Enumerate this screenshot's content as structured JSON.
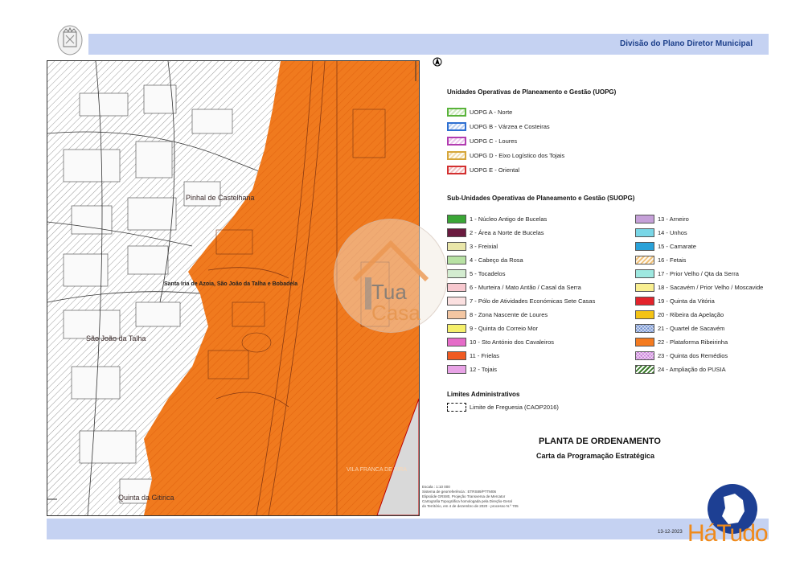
{
  "header": {
    "title": "Divisão do Plano Diretor Municipal"
  },
  "footer": {
    "date": "13-12-2023"
  },
  "map": {
    "places": [
      {
        "name": "Santa Iria de Azoia, São João da Talha e Bobadela"
      },
      {
        "name": "Pinhal de Castelhana"
      },
      {
        "name": "São João da Talha"
      },
      {
        "name": "VILA FRANCA DE XIRA"
      },
      {
        "name": "Quinta da Gitirica"
      }
    ]
  },
  "legend": {
    "uopg_title": "Unidades Operativas de Planeamento e Gestão (UOPG)",
    "uopg": [
      {
        "label": "UOPG A - Norte",
        "color": "#59b33a"
      },
      {
        "label": "UOPG B - Várzea e Costeiras",
        "color": "#2d6fd1"
      },
      {
        "label": "UOPG C - Loures",
        "color": "#b13cb0"
      },
      {
        "label": "UOPG D - Eixo Logístico dos Tojais",
        "color": "#d6a63a"
      },
      {
        "label": "UOPG E - Oriental",
        "color": "#d33030"
      }
    ],
    "suopg_title": "Sub-Unidades Operativas de Planeamento e Gestão (SUOPG)",
    "suopg_left": [
      {
        "label": "1 - Núcleo Antigo de Bucelas",
        "color": "#3aa636"
      },
      {
        "label": "2 - Área a Norte de Bucelas",
        "color": "#6a1a3f"
      },
      {
        "label": "3 - Freixial",
        "color": "#e9e6a9"
      },
      {
        "label": "4 - Cabeço da Rosa",
        "color": "#b8e2a4"
      },
      {
        "label": "5 - Tocadelos",
        "color": "#d3ecd0"
      },
      {
        "label": "6 - Murteira / Mato Antão / Casal da Serra",
        "color": "#f7c8cf"
      },
      {
        "label": "7 - Pólo de Atividades Económicas Sete Casas",
        "color": "#fbe0e0"
      },
      {
        "label": "8 - Zona Nascente de Loures",
        "color": "#f3c6a2"
      },
      {
        "label": "9 - Quinta do Correio Mor",
        "color": "#f5f06b"
      },
      {
        "label": "10 - Sto António dos Cavaleiros",
        "color": "#e56cc8"
      },
      {
        "label": "11 - Frielas",
        "color": "#f05a22"
      },
      {
        "label": "12 - Tojais",
        "color": "#e8a3e6"
      }
    ],
    "suopg_right": [
      {
        "label": "13 - Arneiro",
        "color": "#c5a0d8"
      },
      {
        "label": "14 - Unhos",
        "color": "#79d6e6"
      },
      {
        "label": "15 - Camarate",
        "color": "#2aa2d9"
      },
      {
        "label": "16 - Fetais",
        "color": "#f1c27a"
      },
      {
        "label": "17 - Prior Velho / Qta da Serra",
        "color": "#9ee8e0"
      },
      {
        "label": "18 - Sacavém / Prior Velho / Moscavide",
        "color": "#f9ef91"
      },
      {
        "label": "19 - Quinta da Vitória",
        "color": "#e3232b"
      },
      {
        "label": "20 - Ribeira da Apelação",
        "color": "#f4c314"
      },
      {
        "label": "21 - Quartel de Sacavém",
        "color": "#6e8fd0"
      },
      {
        "label": "22 - Plataforma Ribeirinha",
        "color": "#f47b20"
      },
      {
        "label": "23 - Quinta dos Remédios",
        "color": "#c97bd9"
      },
      {
        "label": "24 - Ampliação do PUSIA",
        "color": "#3a7a2a"
      }
    ],
    "admin_title": "Limites Administrativos",
    "admin_label": "Limite de Freguesia (CAOP2016)"
  },
  "title": {
    "main": "PLANTA DE ORDENAMENTO",
    "sub": "Carta da Programação Estratégica"
  },
  "meta": {
    "lines": [
      "Escala : 1:10 000",
      "Sistema de georreferência : ETRS89/PTTM06",
      "Elipsóide GRS80, Projeção Transversa de Mercator",
      "Cartografia Topográfica homologada pela Direção-Geral",
      "do Território, em 4 de dezembro de 2020 - processo N.º 705"
    ]
  },
  "watermarks": {
    "tua": "Tua",
    "casa": "Casa",
    "site": "HáTudo"
  },
  "colors": {
    "orange_zone": "#f07a1e",
    "header_bar": "#c5d2f2"
  }
}
